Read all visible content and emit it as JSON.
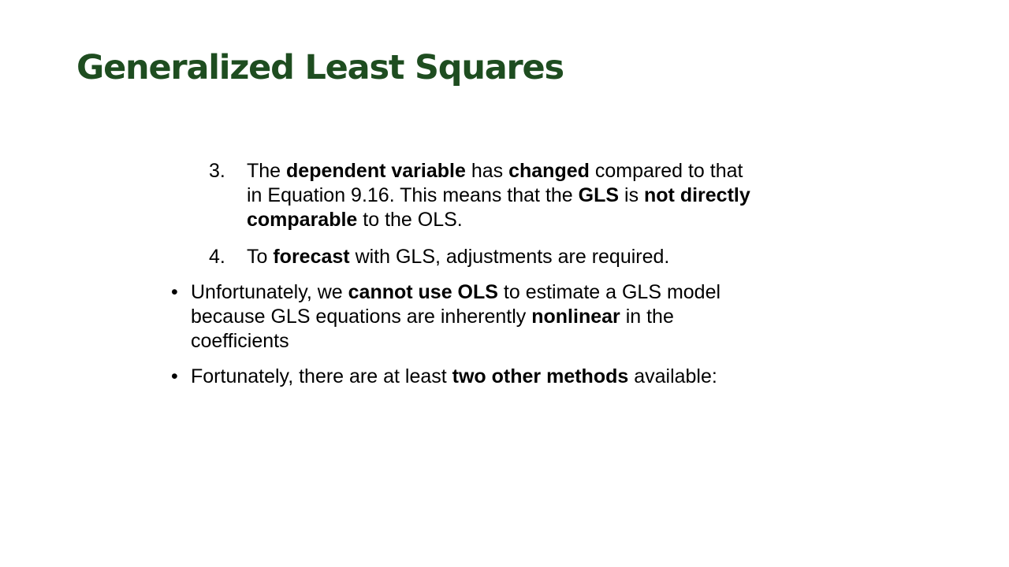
{
  "slide": {
    "title": "Generalized Least Squares",
    "title_color": "#1e4d20",
    "numbered_items": [
      {
        "number": "3.",
        "lines": [
          [
            "The ",
            "dependent variable",
            " has ",
            "changed",
            " compared to that"
          ],
          [
            "in Equation 9.16. This means that the ",
            "GLS",
            " is ",
            "not directly"
          ],
          [
            "comparable",
            " to the OLS."
          ]
        ]
      },
      {
        "number": "4.",
        "lines": [
          [
            "To ",
            "forecast",
            " with GLS, adjustments are required."
          ]
        ]
      }
    ],
    "bullets": [
      {
        "marker": "•",
        "lines": [
          [
            "Unfortunately, we ",
            "cannot use OLS",
            " to estimate a GLS model"
          ],
          [
            "because GLS equations are inherently ",
            "nonlinear",
            " in the"
          ],
          [
            "coefficients"
          ]
        ]
      },
      {
        "marker": "•",
        "lines": [
          [
            "Fortunately, there are at least ",
            "two other methods",
            " available:"
          ]
        ]
      }
    ]
  }
}
